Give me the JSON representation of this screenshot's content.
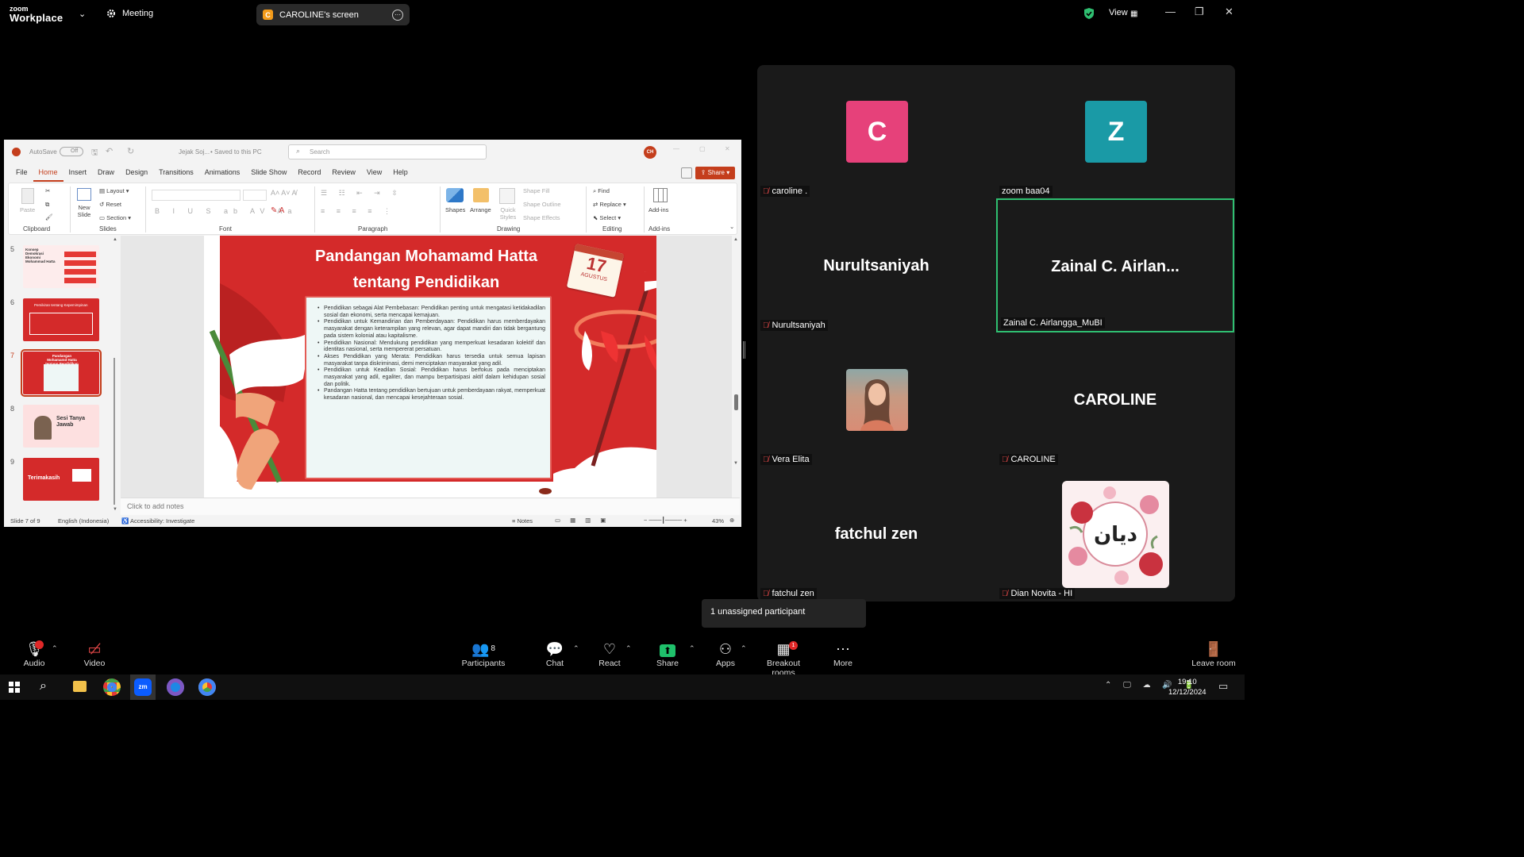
{
  "zoom": {
    "logo_line1": "zoom",
    "logo_line2": "Workplace",
    "meeting_label": "Meeting",
    "screen_share_label": "CAROLINE's screen",
    "screen_share_initial": "C",
    "view_label": "View"
  },
  "ppt": {
    "autosave": "AutoSave",
    "autosave_state": "Off",
    "filename": "Jejak Soj...",
    "saved_status": "• Saved to this PC",
    "search_placeholder": "Search",
    "user_initials": "CH",
    "share_label": "Share",
    "tabs": [
      "File",
      "Home",
      "Insert",
      "Draw",
      "Design",
      "Transitions",
      "Animations",
      "Slide Show",
      "Record",
      "Review",
      "View",
      "Help"
    ],
    "active_tab": "Home",
    "ribbon": {
      "paste": "Paste",
      "clipboard": "Clipboard",
      "new_slide": "New Slide",
      "layout": "Layout",
      "reset": "Reset",
      "section": "Section",
      "slides": "Slides",
      "font": "Font",
      "paragraph": "Paragraph",
      "shapes": "Shapes",
      "arrange": "Arrange",
      "quick_styles": "Quick Styles",
      "shape_fill": "Shape Fill",
      "shape_outline": "Shape Outline",
      "shape_effects": "Shape Effects",
      "drawing": "Drawing",
      "find": "Find",
      "replace": "Replace",
      "select": "Select",
      "editing": "Editing",
      "addins": "Add-ins",
      "addins_group": "Add-ins"
    },
    "thumbnails": [
      {
        "num": "5",
        "text": "Konsep Demokrasi Ekonomi Mohammad Hatta"
      },
      {
        "num": "6",
        "text": "Pemikiran tentang Kepemimpinan"
      },
      {
        "num": "7",
        "text": "Pandangan Mohamamd Hatta tentang Pendidikan"
      },
      {
        "num": "8",
        "text": "Sesi Tanya Jawab"
      },
      {
        "num": "9",
        "text": "Terimakasih"
      }
    ],
    "slide": {
      "title": "Pandangan Mohamamd Hatta tentang Pendidikan",
      "calendar_day": "17",
      "calendar_month": "AGUSTUS",
      "bullets": [
        "Pendidikan sebagai Alat Pembebasan: Pendidikan penting untuk mengatasi ketidakadilan sosial dan ekonomi, serta mencapai kemajuan.",
        "Pendidikan untuk Kemandirian dan Pemberdayaan: Pendidikan harus memberdayakan masyarakat dengan keterampilan yang relevan, agar dapat mandiri dan tidak bergantung pada sistem kolonial atau kapitalisme.",
        "Pendidikan Nasional: Mendukung pendidikan yang memperkuat kesadaran kolektif dan identitas nasional, serta mempererat persatuan.",
        "Akses Pendidikan yang Merata: Pendidikan harus tersedia untuk semua lapisan masyarakat tanpa diskriminasi, demi menciptakan masyarakat yang adil.",
        "Pendidikan untuk Keadilan Sosial: Pendidikan harus berfokus pada menciptakan masyarakat yang adil, egaliter, dan mampu berpartisipasi aktif dalam kehidupan sosial dan politik.",
        "Pandangan Hatta tentang pendidikan bertujuan untuk pemberdayaan rakyat, memperkuat kesadaran nasional, dan mencapai kesejahteraan sosial."
      ]
    },
    "notes_placeholder": "Click to add notes",
    "status": {
      "slide_count": "Slide 7 of 9",
      "language": "English (Indonesia)",
      "accessibility": "Accessibility: Investigate",
      "notes": "Notes",
      "zoom": "43%"
    }
  },
  "participants": [
    {
      "tile": "caroline",
      "avatar": "C",
      "label": "caroline .",
      "color": "#e6417a"
    },
    {
      "tile": "zoom",
      "avatar": "Z",
      "label": "zoom baa04",
      "color": "#1a9aa6"
    },
    {
      "tile": "nurul",
      "bigname": "Nurultsaniyah",
      "label": "Nurultsaniyah"
    },
    {
      "tile": "zainal",
      "bigname": "Zainal C. Airlan...",
      "label": "Zainal C. Airlangga_MuBI"
    },
    {
      "tile": "vera",
      "label": "Vera Elita"
    },
    {
      "tile": "caroline2",
      "bigname": "CAROLINE",
      "label": "CAROLINE"
    },
    {
      "tile": "fatchul",
      "bigname": "fatchul zen",
      "label": "fatchul zen"
    },
    {
      "tile": "dian",
      "label": "Dian Novita - HI",
      "avatar_text": "ديان"
    }
  ],
  "unassigned": "1 unassigned participant",
  "toolbar": {
    "audio": "Audio",
    "video": "Video",
    "participants": "Participants",
    "participants_count": "8",
    "chat": "Chat",
    "react": "React",
    "share": "Share",
    "apps": "Apps",
    "breakout": "Breakout rooms",
    "breakout_badge": "1",
    "more": "More",
    "leave": "Leave room"
  },
  "taskbar": {
    "time": "19:10",
    "date": "12/12/2024"
  },
  "colors": {
    "slide_red": "#d42a2a",
    "zoom_green": "#2fbf71",
    "share_green": "#1fc16b",
    "ppt_accent": "#c43e1c"
  }
}
